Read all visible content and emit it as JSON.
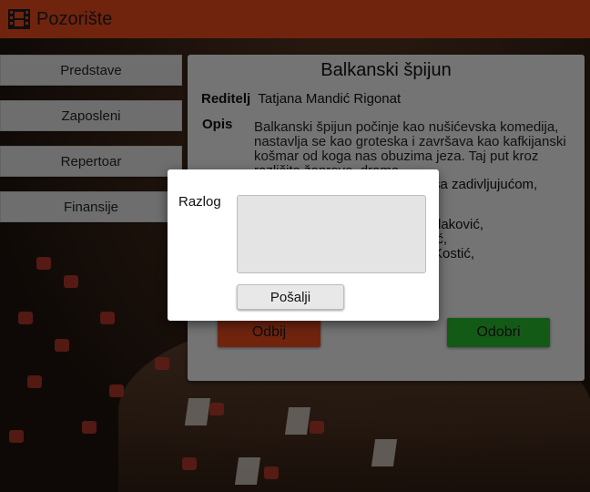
{
  "app": {
    "title": "Pozorište",
    "logo_icon": "film-strip-icon"
  },
  "sidebar": {
    "items": [
      {
        "label": "Predstave"
      },
      {
        "label": "Zaposleni"
      },
      {
        "label": "Repertoar"
      },
      {
        "label": "Finansije"
      }
    ]
  },
  "detail": {
    "title": "Balkanski špijun",
    "director_label": "Reditelj",
    "director_value": "Tatjana Mandić Rigonat",
    "description_label": "Opis",
    "description_visible": "Balkanski špijun počinje kao nušićevska komedija, nastavlja se kao groteska i završava kao kafkijanski košmar od koga nas obuzima jeza. Taj put kroz različite žanrove, drama",
    "description_fragments": [
      "sa zadivljujućom,",
      "daković,",
      "ić,",
      "Kostić,"
    ],
    "reject_label": "Odbij",
    "approve_label": "Odobri"
  },
  "modal": {
    "reason_label": "Razlog",
    "reason_value": "",
    "send_label": "Pošalji"
  },
  "colors": {
    "accent": "#e0481d",
    "approve": "#29b42e",
    "panel": "#e8e8e8"
  }
}
